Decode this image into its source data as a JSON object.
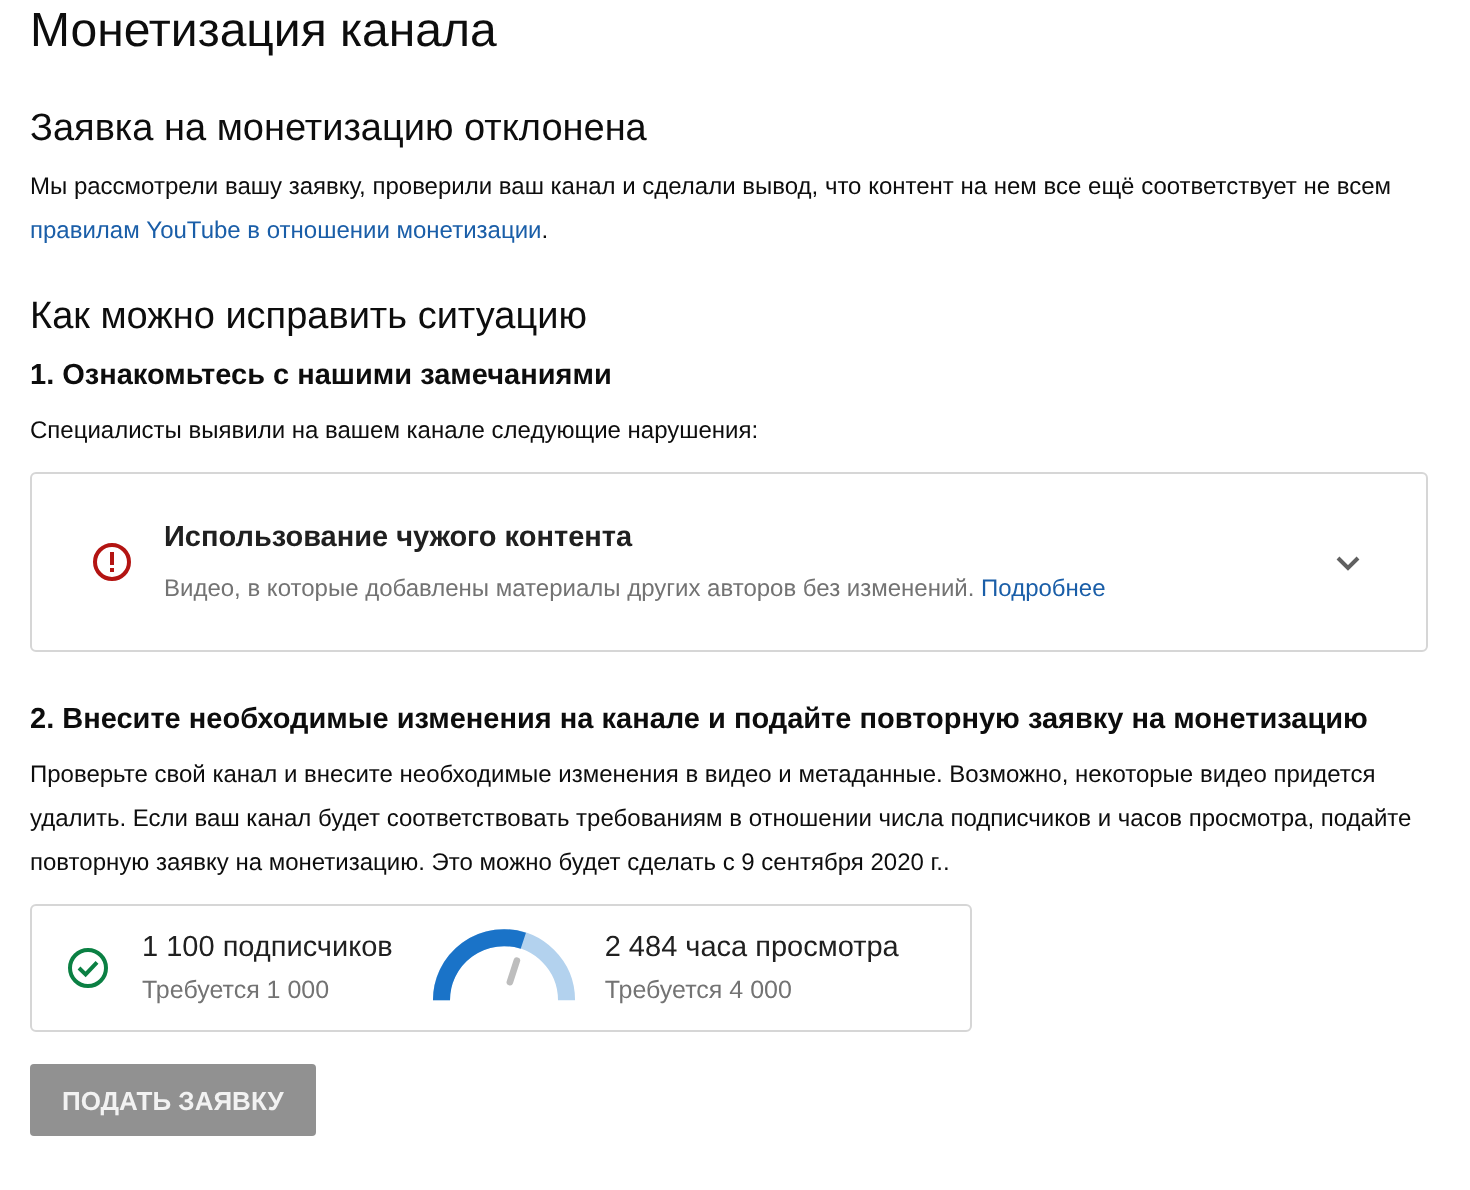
{
  "page_title": "Монетизация канала",
  "rejection": {
    "heading": "Заявка на монетизацию отклонена",
    "text": "Мы рассмотрели вашу заявку, проверили ваш канал и сделали вывод, что контент на нем все ещё соответствует не всем",
    "link": "правилам YouTube в отношении монетизации",
    "after_link": "."
  },
  "fix_heading": "Как можно исправить ситуацию",
  "step1": {
    "heading": "1. Ознакомьтесь с нашими замечаниями",
    "text": "Специалисты выявили на вашем канале следующие нарушения:",
    "issues": [
      {
        "title": "Использование чужого контента",
        "description": "Видео, в которые добавлены материалы других авторов без изменений.",
        "link": "Подробнее",
        "expanded": false
      }
    ]
  },
  "step2": {
    "heading": "2. Внесите необходимые изменения на канале и подайте повторную заявку на монетизацию",
    "text": "Проверьте свой канал и внесите необходимые изменения в видео и метаданные. Возможно, некоторые видео придется удалить. Если ваш канал будет соответствовать требованиям в отношении числа подписчиков и часов просмотра, подайте повторную заявку на монетизацию. Это можно будет сделать с 9 сентября 2020 г..",
    "requirements": [
      {
        "kind": "check",
        "value": "1 100 подписчиков",
        "required": "Требуется 1 000"
      },
      {
        "kind": "gauge",
        "value": "2 484 часа просмотра",
        "required": "Требуется 4 000"
      }
    ]
  },
  "apply_button": {
    "label": "ПОДАТЬ ЗАЯВКУ",
    "disabled": true
  }
}
